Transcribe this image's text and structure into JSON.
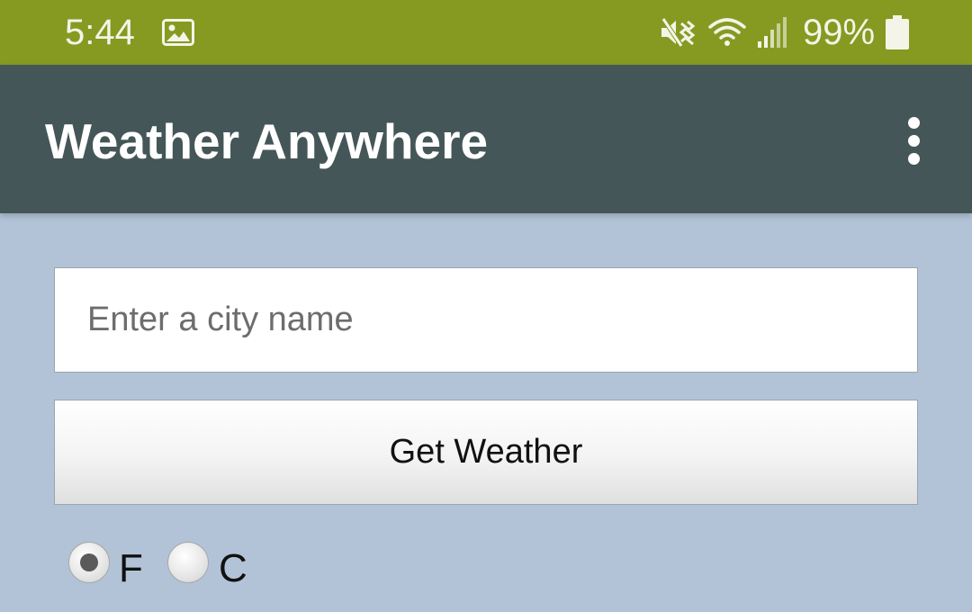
{
  "status_bar": {
    "time": "5:44",
    "battery_percent": "99%",
    "icons": [
      "gallery-icon",
      "mute-vibrate-icon",
      "wifi-icon",
      "signal-icon",
      "battery-icon"
    ],
    "color": "#869a22"
  },
  "app_bar": {
    "title": "Weather Anywhere",
    "menu_icon": "overflow-menu-icon",
    "color": "#445658"
  },
  "city_input": {
    "value": "",
    "placeholder": "Enter a city name"
  },
  "get_weather_button": {
    "label": "Get Weather"
  },
  "units": {
    "options": [
      {
        "label": "F",
        "selected": true
      },
      {
        "label": "C",
        "selected": false
      }
    ]
  },
  "background_color": "#b2c3d7"
}
